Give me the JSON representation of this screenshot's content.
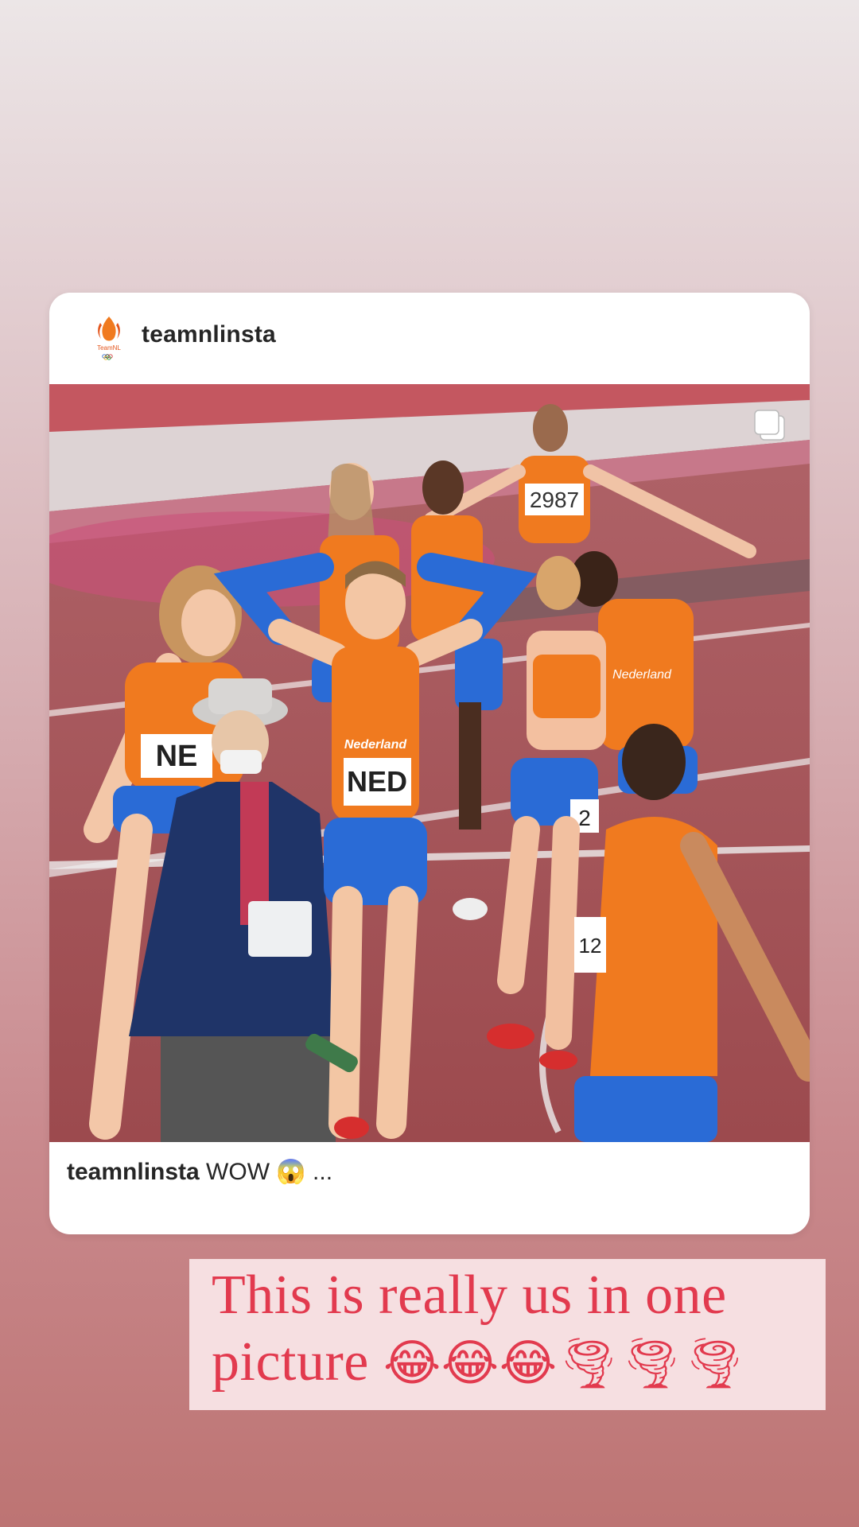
{
  "post": {
    "username": "teamnlinsta",
    "avatar_icon": "teamnl-logo-icon",
    "avatar_caption": "TeamNL",
    "media_type_icon": "carousel-icon",
    "photo": {
      "description_labels": {
        "bib_1": "NED",
        "bib_2": "NE",
        "bib_3": "2987",
        "bib_4": "2",
        "bib_5": "12",
        "shirt_text": "Nederland"
      }
    },
    "caption": {
      "username": "teamnlinsta",
      "text": " WOW 😱 ..."
    }
  },
  "story_text": {
    "line1": "This is really us in one",
    "line2": "picture ",
    "line2_emojis": "😂😂😂🌪🌪🌪"
  },
  "colors": {
    "story_text": "#e23a4e",
    "sticker_bg": "#f6dfe1",
    "accent_orange": "#f07a1f",
    "accent_blue": "#2a6bd6"
  }
}
